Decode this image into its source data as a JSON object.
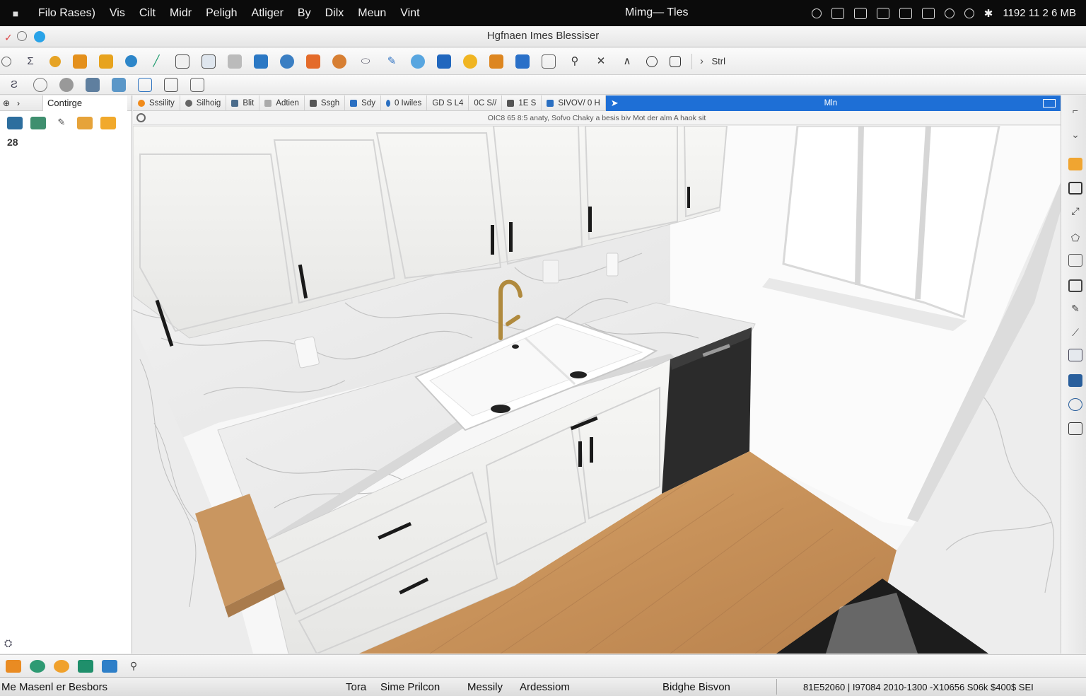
{
  "menubar": {
    "items": [
      "Filo Rases)",
      "Vis",
      "Cilt",
      "Midr",
      "Peligh",
      "Atliger",
      "By",
      "Dilx",
      "Meun",
      "Vint"
    ],
    "center": "Mimg— Tles",
    "clock": "1192 11 2 6 MB"
  },
  "window": {
    "title": "Hgfnaen Imes Blessiser"
  },
  "toolbar2": {
    "label": "Strl"
  },
  "leftpanel": {
    "tab": "Contirge",
    "small_label": "28"
  },
  "viewhead": {
    "tabs": [
      "Sssility",
      "Silhoig",
      "Blit",
      "Adtien",
      "Ssgh",
      "Sdy",
      "0 Iwiles",
      "GD S L4",
      "0C S//",
      "1E S",
      "SIVOV/ 0 H"
    ],
    "active": "Mln"
  },
  "subhead": {
    "text": "OIC8 65 8:5 anaty, Sofvo Chaky a besis biv Mot der alm A haok sit"
  },
  "statusbar": {
    "left": "Me Masenl er Besbors",
    "t1": "Tora",
    "t2": "Sime Prilcon",
    "t3": "Messily",
    "t4": "Ardessiom",
    "t5": "Bidghe Bisvon",
    "coords": "81E52060 | I97084 2010-1300 -X10656 S06k $400$ SEI"
  },
  "colors": {
    "accent": "#1e6fd6",
    "cabinet": "#f4f4f2",
    "wood": "#c9955f",
    "brass": "#b08a3e",
    "dishwasher": "#2b2b2b"
  }
}
